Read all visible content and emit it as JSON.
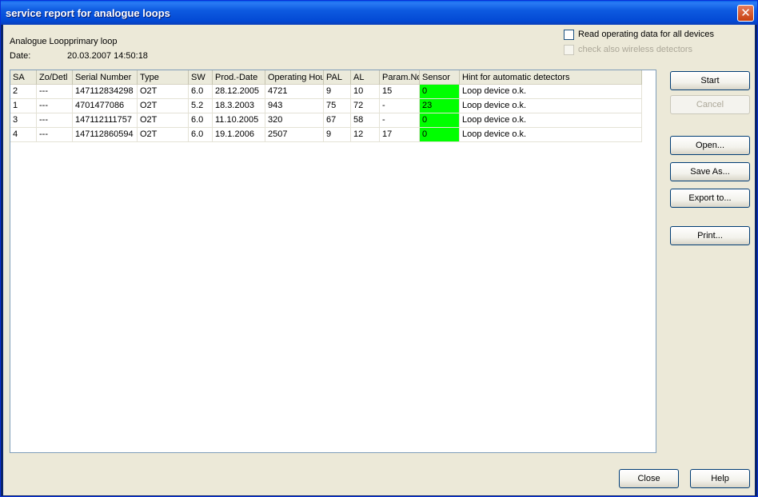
{
  "window": {
    "title": "service report for analogue loops",
    "close_glyph": "✕"
  },
  "info": {
    "loop_label": "Analogue Loopprimary loop",
    "date_label": "Date:",
    "date_value": "20.03.2007 14:50:18"
  },
  "options": {
    "read_all": {
      "label": "Read operating data for all devices",
      "checked": false
    },
    "wireless": {
      "label": "check also wireless detectors",
      "checked": false,
      "disabled": true
    }
  },
  "table": {
    "columns": [
      "SA",
      "Zo/Detl",
      "Serial Number",
      "Type",
      "SW",
      "Prod.-Date",
      "Operating Hou",
      "PAL",
      "AL",
      "Param.No",
      "Sensor",
      "Hint for automatic detectors"
    ],
    "rows": [
      [
        "2",
        "---",
        "147112834298",
        "O2T",
        "6.0",
        "28.12.2005",
        "4721",
        "9",
        "10",
        "15",
        "0",
        "Loop device o.k."
      ],
      [
        "1",
        "---",
        "4701477086",
        "O2T",
        "5.2",
        "18.3.2003",
        "943",
        "75",
        "72",
        "-",
        "23",
        "Loop device o.k."
      ],
      [
        "3",
        "---",
        "147112111757",
        "O2T",
        "6.0",
        "11.10.2005",
        "320",
        "67",
        "58",
        "-",
        "0",
        "Loop device o.k."
      ],
      [
        "4",
        "---",
        "147112860594",
        "O2T",
        "6.0",
        "19.1.2006",
        "2507",
        "9",
        "12",
        "17",
        "0",
        "Loop device o.k."
      ]
    ],
    "sensor_color": "#00ff00"
  },
  "buttons": {
    "start": "Start",
    "cancel": "Cancel",
    "open": "Open...",
    "save_as": "Save As...",
    "export_to": "Export to...",
    "print": "Print...",
    "close": "Close",
    "help": "Help"
  },
  "colors": {
    "titlebar": "#0a5fe8",
    "dialog_bg": "#ece9d8"
  }
}
